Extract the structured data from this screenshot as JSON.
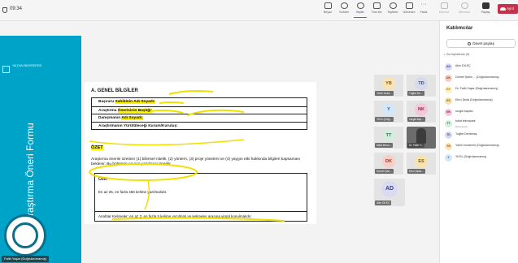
{
  "topbar": {
    "timer": "09:34",
    "buttons": [
      {
        "label": "Beyaz",
        "icon": "whiteboard-icon"
      },
      {
        "label": "Sohbet",
        "icon": "chat-icon"
      },
      {
        "label": "Kişiler",
        "icon": "people-icon",
        "active": true
      },
      {
        "label": "Tüm ele",
        "icon": "raise-hand-icon"
      },
      {
        "label": "Tepkiver",
        "icon": "react-icon"
      },
      {
        "label": "Görünüm",
        "icon": "view-icon"
      },
      {
        "label": "Fazla",
        "icon": "more-icon"
      },
      {
        "label": "Kamera",
        "icon": "camera-icon",
        "dim": true
      },
      {
        "label": "Mikrofon",
        "icon": "mic-icon",
        "dim": true
      },
      {
        "label": "Paylaş",
        "icon": "share-screen-icon"
      }
    ],
    "leave_label": "Ayrıl",
    "accent": "#5b5fc7",
    "leave_color": "#c4314b"
  },
  "slide": {
    "band_color": "#00a3c8",
    "university_name": "YALOVA ÜNİVERSİTESİ",
    "vertical_title": "Araştırma Öneri Formu",
    "presenter_tag": "Fatih Yaşar (Doğrulanmamış)"
  },
  "document": {
    "section_title": "A. GENEL BİLGİLER",
    "rows": [
      {
        "pre": "Başvuru ",
        "highlight": "Sahibinin Adı Soyadı:",
        "post": ""
      },
      {
        "pre": "Araştırma ",
        "highlight": "Önerisinin Başlığı:",
        "post": ""
      },
      {
        "pre": "Danışmanın ",
        "highlight": "Adı Soyadı:",
        "post": ""
      },
      {
        "pre": "Araştırmanın Yürütüleceği Kurum/Kuruluş:",
        "highlight": "",
        "post": ""
      }
    ],
    "ozet_title": "ÖZET",
    "ozet_text": "Araştırma önerisi özetinin (1) bilimsel nitelik, (2) yöntem, (3) proje yönetimi ve (4) yaygın etki hakkında bilgileri kapsaması beklenir. Bu bölümün en son yazılması önerilir.",
    "box_title": "Özet",
    "box_text": "En az 25, en fazla 450 kelime yazılmalıdır.",
    "keywords": "Anahtar Kelimeler: en az 3, en fazla 5 kelime yazılmalı ve kelimeler arasına virgül konulmalıdır.",
    "highlight_color": "#fff200"
  },
  "tiles": [
    {
      "initials": "YB",
      "label": "Yaren bozd...",
      "bg": "#fbe3b8",
      "fg": "#8a5a00"
    },
    {
      "initials": "TD",
      "label": "Tuğba De...",
      "bg": "#d6dbe9",
      "fg": "#3b4a73"
    },
    {
      "initials": "Y",
      "label": "YKGL (Doğ...",
      "bg": "#d3e7f7",
      "fg": "#1f5e8c"
    },
    {
      "initials": "NK",
      "label": "nurgül kap...",
      "bg": "#f3c9d9",
      "fg": "#8a2350"
    },
    {
      "initials": "TT",
      "label": "tokat tekno...",
      "bg": "#d5ecdf",
      "fg": "#2d6a48"
    },
    {
      "initials": "",
      "label": "Dr. Fatih Y...",
      "video": true
    },
    {
      "initials": "DK",
      "label": "Dornet Şah...",
      "bg": "#f6d0c8",
      "fg": "#8f3522"
    },
    {
      "initials": "ES",
      "label": "Ebru Şeda...",
      "bg": "#f5e3b0",
      "fg": "#7d5a00"
    },
    {
      "initials": "AD",
      "label": "Alim DİLEÇ",
      "bg": "#d9dbf3",
      "fg": "#3a3f8c"
    }
  ],
  "panel": {
    "title": "Katılımcılar",
    "share_label": "Davet paylaş",
    "section_header": "Bu toplantıda (9)",
    "people": [
      {
        "initials": "AD",
        "name": "Alim DİLEÇ",
        "sub": "",
        "bg": "#d9dbf3",
        "fg": "#3a3f8c"
      },
      {
        "initials": "DK",
        "name": "Dornet Şahin ... (Doğrulanmamış)",
        "sub": "",
        "bg": "#f6d0c8",
        "fg": "#8f3522"
      },
      {
        "initials": "DY",
        "name": "Dr. Fatih Yaşar (Doğrulanmamış)",
        "sub": "",
        "bg": "#fff0c2",
        "fg": "#8a6a00"
      },
      {
        "initials": "ES",
        "name": "Ebru Şeda (Doğrulanmamış)",
        "sub": "",
        "bg": "#f5e3b0",
        "fg": "#7d5a00"
      },
      {
        "initials": "NK",
        "name": "nurgül kaplan",
        "sub": "",
        "bg": "#f3c9d9",
        "fg": "#8a2350"
      },
      {
        "initials": "TT",
        "name": "tokat teknopark",
        "sub": "Düzenleyici",
        "bg": "#d5ecdf",
        "fg": "#2d6a48"
      },
      {
        "initials": "TD",
        "name": "Tuğba Demirbaş",
        "sub": "",
        "bg": "#d6dbe9",
        "fg": "#3b4a73"
      },
      {
        "initials": "YB",
        "name": "Yaren bozdemir (Doğrulanmamış)",
        "sub": "",
        "bg": "#fbe3b8",
        "fg": "#8a5a00"
      },
      {
        "initials": "Y",
        "name": "YKGL (Doğrulanmamış)",
        "sub": "",
        "bg": "#d3e7f7",
        "fg": "#1f5e8c"
      }
    ]
  }
}
